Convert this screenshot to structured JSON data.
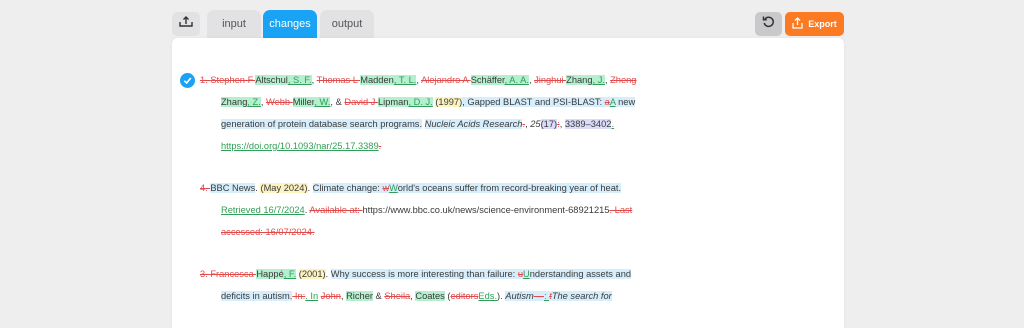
{
  "tabs": [
    {
      "label": "input"
    },
    {
      "label": "changes"
    },
    {
      "label": "output"
    }
  ],
  "export_label": "Export",
  "colors": {
    "accent": "#1aa3f4",
    "export": "#fb7a22",
    "inserted": "#2f9e57",
    "deleted": "#e04a4a"
  },
  "icons": {
    "back": "return-icon",
    "undo": "undo-icon",
    "export": "share-icon",
    "check": "check-circle-icon"
  },
  "refs": [
    {
      "lines": [
        [
          {
            "t": "1. ",
            "c": "del"
          },
          {
            "t": "Stephen F ",
            "c": "del"
          },
          {
            "t": "Altschul",
            "c": "gh"
          },
          {
            "t": ", S. F.",
            "c": "ins gh"
          },
          {
            "t": ", ",
            "c": ""
          },
          {
            "t": "Thomas L ",
            "c": "del"
          },
          {
            "t": "Madden",
            "c": "gh"
          },
          {
            "t": ", T. L.",
            "c": "ins gh"
          },
          {
            "t": ", ",
            "c": ""
          },
          {
            "t": "Alejandro A ",
            "c": "del"
          },
          {
            "t": "Schäffer",
            "c": "gh"
          },
          {
            "t": ", A. A.",
            "c": "ins gh"
          },
          {
            "t": ", ",
            "c": ""
          },
          {
            "t": "Jinghui ",
            "c": "del"
          },
          {
            "t": "Zhang",
            "c": "gh"
          },
          {
            "t": ", J.",
            "c": "ins gh"
          },
          {
            "t": ", ",
            "c": ""
          },
          {
            "t": "Zheng",
            "c": "del"
          }
        ],
        [
          {
            "t": "Zhang",
            "c": "gh"
          },
          {
            "t": ", Z.",
            "c": "ins gh"
          },
          {
            "t": ", ",
            "c": ""
          },
          {
            "t": "Webb ",
            "c": "del"
          },
          {
            "t": "Miller",
            "c": "gh"
          },
          {
            "t": ", W.",
            "c": "ins gh"
          },
          {
            "t": ", & ",
            "c": ""
          },
          {
            "t": "David J ",
            "c": "del"
          },
          {
            "t": "Lipman",
            "c": "gh"
          },
          {
            "t": ", D. J.",
            "c": "ins gh"
          },
          {
            "t": " ",
            "c": ""
          },
          {
            "t": "(1997)",
            "c": "yh"
          },
          {
            "t": ", Gapped BLAST and PSI-BLAST: ",
            "c": "bh"
          },
          {
            "t": "a",
            "c": "del bh"
          },
          {
            "t": "A",
            "c": "ins bh"
          },
          {
            "t": " new",
            "c": "bh"
          }
        ],
        [
          {
            "t": "generation of protein database search programs.",
            "c": "bh"
          },
          {
            "t": " ",
            "c": ""
          },
          {
            "t": "Nucleic Acids Research",
            "c": "it bh"
          },
          {
            "t": ".",
            "c": "del"
          },
          {
            "t": ", ",
            "c": ""
          },
          {
            "t": "25",
            "c": "it"
          },
          {
            "t": "(17)",
            "c": "ph"
          },
          {
            "t": ":",
            "c": "del"
          },
          {
            "t": ", ",
            "c": ""
          },
          {
            "t": "3389–3402",
            "c": "ph"
          },
          {
            "t": ".",
            "c": "ins"
          }
        ],
        [
          {
            "t": "https://doi.org/10.1093/nar/25.17.3389",
            "c": "link"
          },
          {
            "t": ".",
            "c": "del"
          }
        ]
      ]
    },
    {
      "lines": [
        [
          {
            "t": "4. ",
            "c": "del"
          },
          {
            "t": "BBC News",
            "c": "bh"
          },
          {
            "t": ". ",
            "c": ""
          },
          {
            "t": "(May 2024)",
            "c": "yh"
          },
          {
            "t": ". ",
            "c": ""
          },
          {
            "t": "Climate change: ",
            "c": "bh"
          },
          {
            "t": "w",
            "c": "del bh"
          },
          {
            "t": "W",
            "c": "ins bh"
          },
          {
            "t": "orld's oceans suffer from record-breaking year of heat.",
            "c": "bh"
          }
        ],
        [
          {
            "t": "Retrieved 16/7/2024",
            "c": "ins"
          },
          {
            "t": ". ",
            "c": ""
          },
          {
            "t": "Available at: ",
            "c": "del"
          },
          {
            "t": "https://www.bbc.co.uk/news/science-environment-68921215",
            "c": ""
          },
          {
            "t": ". Last",
            "c": "del"
          }
        ],
        [
          {
            "t": "accessed: 16/07/2024.",
            "c": "del"
          }
        ]
      ]
    },
    {
      "lines": [
        [
          {
            "t": "3. ",
            "c": "del"
          },
          {
            "t": "Francesca ",
            "c": "del"
          },
          {
            "t": "Happé",
            "c": "gh"
          },
          {
            "t": ", F.",
            "c": "ins gh"
          },
          {
            "t": " ",
            "c": ""
          },
          {
            "t": "(2001)",
            "c": "yh"
          },
          {
            "t": ". ",
            "c": ""
          },
          {
            "t": "Why success is more interesting than failure: ",
            "c": "bh"
          },
          {
            "t": "u",
            "c": "del bh"
          },
          {
            "t": "U",
            "c": "ins bh"
          },
          {
            "t": "nderstanding assets and",
            "c": "bh"
          }
        ],
        [
          {
            "t": "deficits in autism.",
            "c": "bh"
          },
          {
            "t": " In:",
            "c": "del"
          },
          {
            "t": ". In",
            "c": "ins"
          },
          {
            "t": " ",
            "c": ""
          },
          {
            "t": "John",
            "c": "del"
          },
          {
            "t": ", ",
            "c": ""
          },
          {
            "t": "Richer",
            "c": "gh"
          },
          {
            "t": " & ",
            "c": ""
          },
          {
            "t": "Sheila",
            "c": "del"
          },
          {
            "t": ", ",
            "c": ""
          },
          {
            "t": "Coates",
            "c": "gh"
          },
          {
            "t": " (",
            "c": ""
          },
          {
            "t": "editors",
            "c": "del"
          },
          {
            "t": "Eds.",
            "c": "ins"
          },
          {
            "t": "). ",
            "c": ""
          },
          {
            "t": "Autism",
            "c": "it bh"
          },
          {
            "t": " – ",
            "c": "del bh"
          },
          {
            "t": ": ",
            "c": "ins bh"
          },
          {
            "t": "t",
            "c": "del it bh"
          },
          {
            "t": "The search for",
            "c": "it bh"
          }
        ]
      ]
    }
  ]
}
